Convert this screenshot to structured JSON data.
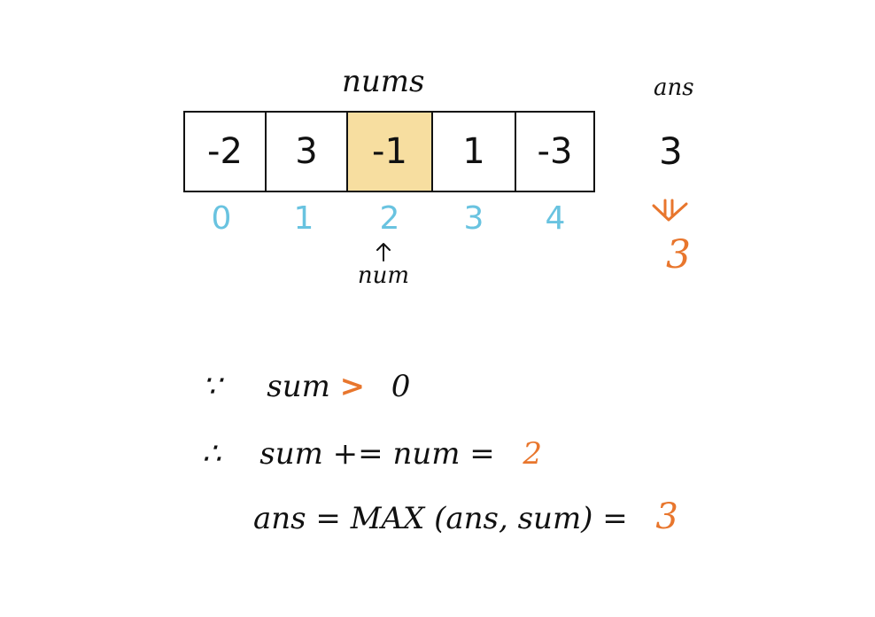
{
  "labels": {
    "nums": "nums",
    "ans": "ans",
    "num": "num"
  },
  "array": {
    "cells": [
      "-2",
      "3",
      "-1",
      "1",
      "-3"
    ],
    "highlight_index": 2,
    "indices": [
      "0",
      "1",
      "2",
      "3",
      "4"
    ]
  },
  "ans": {
    "before": "3",
    "after": "3"
  },
  "steps": {
    "because_symbol": "∵",
    "line1_left": "sum",
    "line1_op": ">",
    "line1_right": "0",
    "therefore_symbol": "∴",
    "line2_left": "sum += num =",
    "line2_value": "2",
    "line3_left": "ans = MAX (ans, sum) =",
    "line3_value": "3"
  },
  "colors": {
    "highlight_fill": "#f7dea0",
    "index_color": "#69c3e0",
    "accent_orange": "#e8762d",
    "ink": "#111111"
  }
}
